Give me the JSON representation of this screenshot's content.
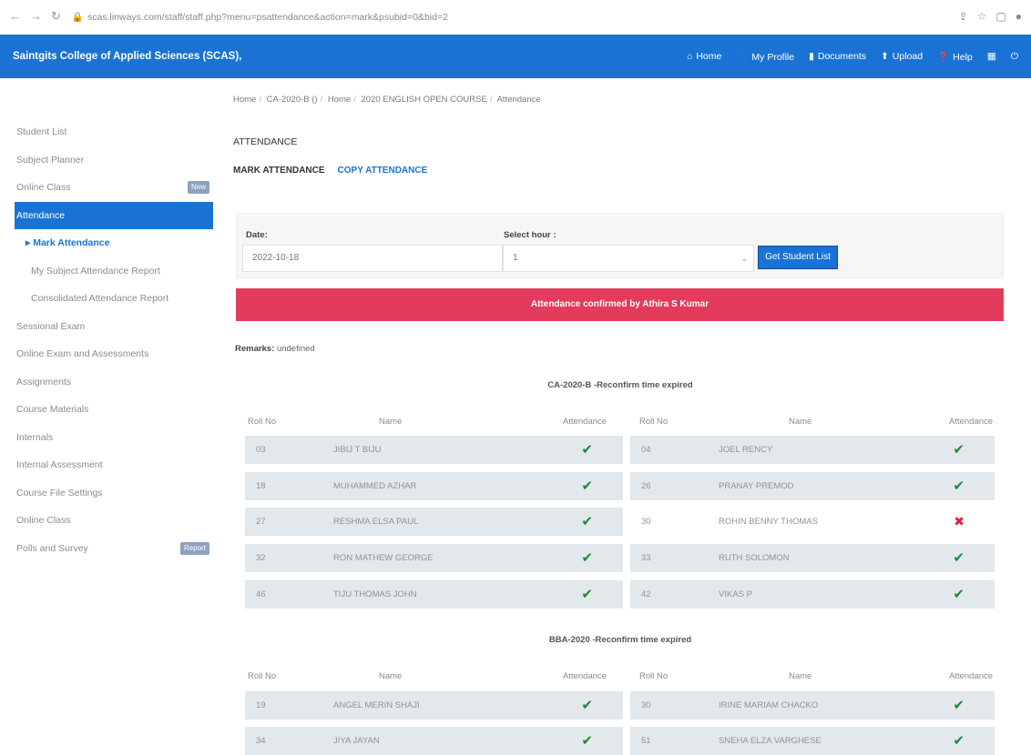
{
  "browser": {
    "url": "scas.linways.com/staff/staff.php?menu=psattendance&action=mark&psubid=0&bid=2"
  },
  "header": {
    "brand": "Saintgits College of Applied Sciences (SCAS),",
    "menu": [
      {
        "label": "Home",
        "icon": "home-icon"
      },
      {
        "label": "My Profile",
        "icon": "user-icon"
      },
      {
        "label": "Documents",
        "icon": "document-icon"
      },
      {
        "label": "Upload",
        "icon": "upload-icon"
      },
      {
        "label": "Help",
        "icon": "help-icon"
      }
    ]
  },
  "sidebar": {
    "items": [
      {
        "label": "Student List"
      },
      {
        "label": "Subject Planner"
      },
      {
        "label": "Online Class",
        "badge": "New"
      },
      {
        "label": "Attendance",
        "active": true
      },
      {
        "label": "Mark Attendance",
        "sub": true,
        "current": true
      },
      {
        "label": "My Subject Attendance Report",
        "sub": true
      },
      {
        "label": "Consolidated Attendance Report",
        "sub": true
      },
      {
        "label": "Sessional Exam"
      },
      {
        "label": "Online Exam and Assessments"
      },
      {
        "label": "Assignments"
      },
      {
        "label": "Course Materials"
      },
      {
        "label": "Internals"
      },
      {
        "label": "Internal Assessment"
      },
      {
        "label": "Course File Settings"
      },
      {
        "label": "Online Class"
      },
      {
        "label": "Polls and Survey",
        "badge": "Report"
      }
    ]
  },
  "breadcrumb": [
    "Home",
    "CA-2020-B ()",
    "Home",
    "2020 ENGLISH OPEN COURSE",
    "Attendance"
  ],
  "page_title": "ATTENDANCE",
  "tabs": {
    "mark": "MARK ATTENDANCE",
    "copy": "COPY ATTENDANCE"
  },
  "form": {
    "date_label": "Date:",
    "date_value": "2022-10-18",
    "hour_label": "Select hour :",
    "hour_value": "1",
    "button": "Get Student List"
  },
  "alert": "Attendance confirmed by Athira S Kumar",
  "remarks": {
    "label": "Remarks:",
    "value": "undefined"
  },
  "columns": {
    "roll": "Roll No",
    "name": "Name",
    "attendance": "Attendance"
  },
  "sections": [
    {
      "title": "CA-2020-B -Reconfirm time expired",
      "left": [
        {
          "roll": "03",
          "name": "JIBIJ T BIJU",
          "present": true
        },
        {
          "roll": "18",
          "name": "MUHAMMED AZHAR",
          "present": true
        },
        {
          "roll": "27",
          "name": "RESHMA ELSA PAUL",
          "present": true
        },
        {
          "roll": "32",
          "name": "RON MATHEW GEORGE",
          "present": true
        },
        {
          "roll": "46",
          "name": "TIJU THOMAS JOHN",
          "present": true
        }
      ],
      "right": [
        {
          "roll": "04",
          "name": "JOEL RENCY",
          "present": true
        },
        {
          "roll": "26",
          "name": "PRANAY PREMOD",
          "present": true
        },
        {
          "roll": "30",
          "name": "ROHIN BENNY THOMAS",
          "present": false
        },
        {
          "roll": "33",
          "name": "RUTH SOLOMON",
          "present": true
        },
        {
          "roll": "42",
          "name": "VIKAS P",
          "present": true
        }
      ]
    },
    {
      "title": "BBA-2020 -Reconfirm time expired",
      "left": [
        {
          "roll": "19",
          "name": "ANGEL MERIN SHAJI",
          "present": true
        },
        {
          "roll": "34",
          "name": "JIYA JAYAN",
          "present": true
        }
      ],
      "right": [
        {
          "roll": "30",
          "name": "IRINE MARIAM CHACKO",
          "present": true
        },
        {
          "roll": "51",
          "name": "SNEHA ELZA VARGHESE",
          "present": true
        }
      ]
    }
  ],
  "icons": {
    "present": "✔",
    "absent": "✖"
  },
  "colors": {
    "brand": "#1a73d4",
    "alert": "#e23b5c",
    "present": "#1a8a3a",
    "absent": "#e02040"
  }
}
